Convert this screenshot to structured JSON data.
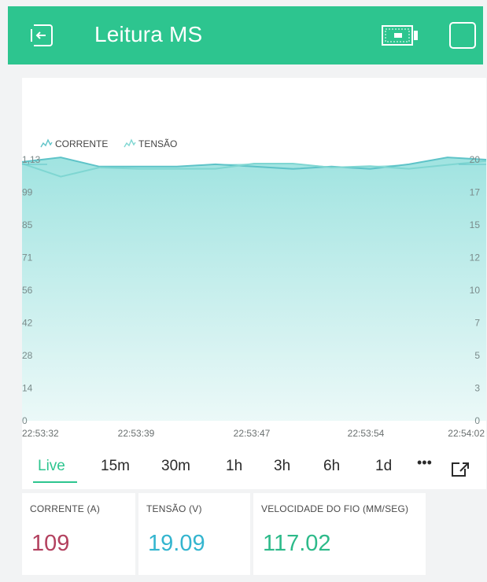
{
  "header": {
    "title": "Leitura MS",
    "background": "#2dc58f",
    "icons": {
      "back": "exit-icon",
      "battery": "battery-icon",
      "square": "square-icon"
    }
  },
  "chart_data": {
    "type": "area",
    "series": [
      {
        "name": "CORRENTE",
        "color": "#5ec3c8",
        "values": [
          112,
          114,
          110,
          110,
          110,
          111,
          110,
          109,
          110,
          109,
          111,
          114,
          113
        ]
      },
      {
        "name": "TENSÃO",
        "color": "#7fd6d2",
        "values": [
          19.7,
          18.7,
          19.4,
          19.3,
          19.3,
          19.3,
          19.7,
          19.7,
          19.4,
          19.5,
          19.3,
          19.6,
          19.9
        ]
      }
    ],
    "x_tick_labels": [
      "22:53:32",
      "22:53:39",
      "22:53:47",
      "22:53:54",
      "22:54:02"
    ],
    "y_left_ticks": [
      "0",
      "14",
      "28",
      "42",
      "56",
      "71",
      "85",
      "99",
      "1,13"
    ],
    "y_right_ticks": [
      "0",
      "3",
      "5",
      "7",
      "10",
      "12",
      "15",
      "17",
      "20"
    ],
    "ylim_left": [
      0,
      113
    ],
    "ylim_right": [
      0,
      20
    ],
    "legend": [
      "CORRENTE",
      "TENSÃO"
    ],
    "legend_placement": "top-left",
    "grid": false
  },
  "time_ranges": [
    "Live",
    "15m",
    "30m",
    "1h",
    "3h",
    "6h",
    "1d",
    "•••"
  ],
  "active_range": "Live",
  "tiles": [
    {
      "label": "CORRENTE (A)",
      "value": "109",
      "color": "#b3415f"
    },
    {
      "label": "TENSÃO (V)",
      "value": "19.09",
      "color": "#34b5cf"
    },
    {
      "label": "VELOCIDADE DO FIO (MM/SEG)",
      "value": "117.02",
      "color": "#2dba8a"
    }
  ],
  "colors": {
    "accent": "#2dc58f"
  }
}
